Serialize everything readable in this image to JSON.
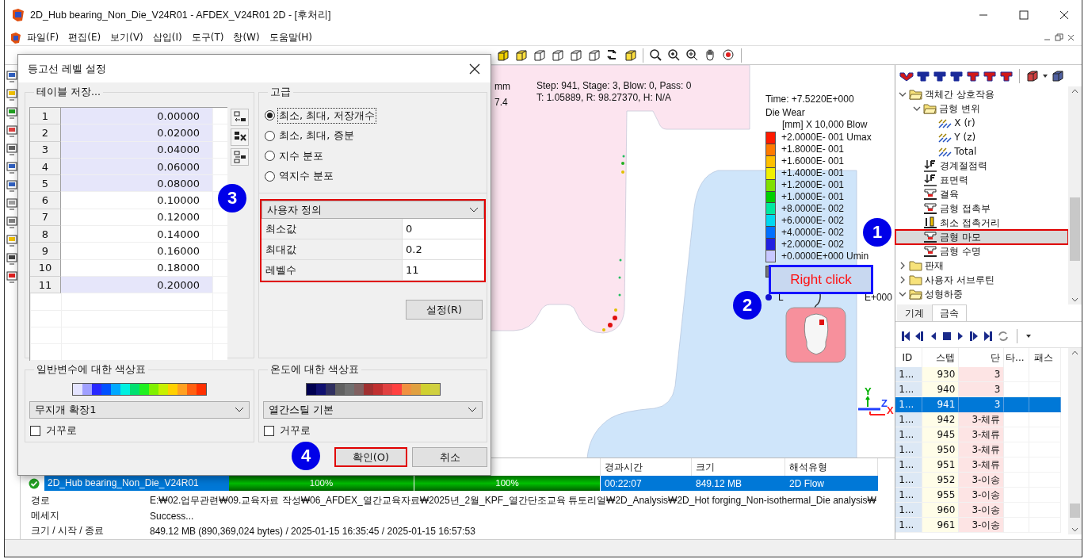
{
  "window": {
    "title": "2D_Hub bearing_Non_Die_V24R01 - AFDEX_V24R01 2D - [후처리]"
  },
  "menu": [
    "파일(F)",
    "편집(E)",
    "보기(V)",
    "삽입(I)",
    "도구(T)",
    "창(W)",
    "도움말(H)"
  ],
  "viewport": {
    "corner_texts": [
      "mm",
      "7.4"
    ],
    "step_info": [
      "Step: 941, Stage: 3, Blow: 0, Pass: 0",
      "T: 1.05889, R: 98.27370, H: N/A"
    ],
    "legend": {
      "time": "Time: +7.5220E+000",
      "variable": "Die Wear",
      "unit": "[mm] X 10,000 Blow",
      "footer_left": "L",
      "footer_right": "E+000",
      "levels": [
        {
          "label": "+2.0000E- 001 Umax",
          "color": "#ff1a00"
        },
        {
          "label": "+1.8000E- 001",
          "color": "#ff7a00"
        },
        {
          "label": "+1.6000E- 001",
          "color": "#ffc000"
        },
        {
          "label": "+1.4000E- 001",
          "color": "#f0f000"
        },
        {
          "label": "+1.2000E- 001",
          "color": "#80e000"
        },
        {
          "label": "+1.0000E- 001",
          "color": "#00d000"
        },
        {
          "label": "+8.0000E- 002",
          "color": "#00e8a0"
        },
        {
          "label": "+6.0000E- 002",
          "color": "#00d8f0"
        },
        {
          "label": "+4.0000E- 002",
          "color": "#0070ff"
        },
        {
          "label": "+2.0000E- 002",
          "color": "#2020e0"
        },
        {
          "label": "+0.0000E+000 Umin",
          "color": "#c8c8ff"
        }
      ]
    },
    "axes": [
      {
        "label": "Y",
        "color": "#00b000"
      },
      {
        "label": "Z",
        "color": "#2040ff"
      },
      {
        "label": "X",
        "color": "#ff2020"
      }
    ]
  },
  "dialog": {
    "title": "등고선 레벨 설정",
    "table_group": {
      "title": "테이블 저장...",
      "rows": [
        {
          "index": "1",
          "value": "0.00000",
          "selected": true
        },
        {
          "index": "2",
          "value": "0.02000",
          "selected": true
        },
        {
          "index": "3",
          "value": "0.04000",
          "selected": true
        },
        {
          "index": "4",
          "value": "0.06000",
          "selected": true
        },
        {
          "index": "5",
          "value": "0.08000",
          "selected": true
        },
        {
          "index": "6",
          "value": "0.10000",
          "selected": false
        },
        {
          "index": "7",
          "value": "0.12000",
          "selected": false
        },
        {
          "index": "8",
          "value": "0.14000",
          "selected": false
        },
        {
          "index": "9",
          "value": "0.16000",
          "selected": false
        },
        {
          "index": "10",
          "value": "0.18000",
          "selected": false
        },
        {
          "index": "11",
          "value": "0.20000",
          "selected": true
        }
      ]
    },
    "advanced": {
      "title": "고급",
      "options": [
        {
          "label": "최소, 최대, 저장개수",
          "selected": true
        },
        {
          "label": "최소, 최대, 증분",
          "selected": false
        },
        {
          "label": "지수 분포",
          "selected": false
        },
        {
          "label": "역지수 분포",
          "selected": false
        }
      ],
      "user_defined": {
        "highlighted": true,
        "mode": "사용자 정의",
        "fields": [
          {
            "label": "최소값",
            "value": "0"
          },
          {
            "label": "최대값",
            "value": "0.2"
          },
          {
            "label": "레벨수",
            "value": "11"
          }
        ]
      },
      "apply_button": "설정(R)"
    },
    "colormaps": [
      {
        "title": "일반변수에 대한 색상표",
        "value": "무지개 확장1",
        "reversed_label": "거꾸로",
        "reversed": false,
        "swatches": [
          {
            "color": "#e4e4ff"
          },
          {
            "color": "#a0a0ff"
          },
          {
            "color": "#2828ff"
          },
          {
            "color": "#0050ff"
          },
          {
            "color": "#00a8ff"
          },
          {
            "color": "#00f0e0"
          },
          {
            "color": "#00e070"
          },
          {
            "color": "#20f020"
          },
          {
            "color": "#80f000"
          },
          {
            "color": "#c8f000"
          },
          {
            "color": "#ffd000"
          },
          {
            "color": "#ffa020"
          },
          {
            "color": "#ff6010"
          },
          {
            "color": "#ff3000"
          }
        ]
      },
      {
        "title": "온도에 대한 색상표",
        "value": "열간스틸 기본",
        "reversed_label": "거꾸로",
        "reversed": false,
        "swatches": [
          {
            "color": "#000050"
          },
          {
            "color": "#101070"
          },
          {
            "color": "#303060"
          },
          {
            "color": "#606060"
          },
          {
            "color": "#707070"
          },
          {
            "color": "#806060"
          },
          {
            "color": "#a03030"
          },
          {
            "color": "#c03030"
          },
          {
            "color": "#e04040"
          },
          {
            "color": "#ff4040"
          },
          {
            "color": "#f09040"
          },
          {
            "color": "#e0a040"
          },
          {
            "color": "#d0d030"
          },
          {
            "color": "#d0d040"
          }
        ]
      }
    ],
    "buttons": [
      {
        "label": "확인(O)",
        "highlighted": true
      },
      {
        "label": "취소",
        "highlighted": false
      }
    ]
  },
  "right_panel": {
    "tree": [
      {
        "label": "객체간 상호작용",
        "kind": "folder",
        "expanded": true,
        "selected": false,
        "highlighted": false,
        "children": [
          {
            "label": "금형 변위",
            "kind": "folder",
            "expanded": true,
            "selected": false,
            "highlighted": false,
            "children": [
              {
                "label": "X (r)",
                "kind": "vector",
                "selected": false,
                "highlighted": false
              },
              {
                "label": "Y (z)",
                "kind": "vector",
                "selected": false,
                "highlighted": false
              },
              {
                "label": "Total",
                "kind": "vector",
                "selected": false,
                "highlighted": false
              }
            ]
          },
          {
            "label": "경계절점력",
            "kind": "force",
            "selected": false,
            "highlighted": false
          },
          {
            "label": "표면력",
            "kind": "force",
            "selected": false,
            "highlighted": false
          },
          {
            "label": "결육",
            "kind": "die",
            "selected": false,
            "highlighted": false
          },
          {
            "label": "금형 접촉부",
            "kind": "die",
            "selected": false,
            "highlighted": false
          },
          {
            "label": "최소 접촉거리",
            "kind": "gauge",
            "selected": false,
            "highlighted": false
          },
          {
            "label": "금형 마모",
            "kind": "die",
            "selected": true,
            "highlighted": true
          },
          {
            "label": "금형 수명",
            "kind": "die",
            "selected": false,
            "highlighted": false
          }
        ]
      },
      {
        "label": "판재",
        "kind": "folder",
        "expanded": false,
        "selected": false,
        "highlighted": false
      },
      {
        "label": "사용자 서브루틴",
        "kind": "folder",
        "expanded": false,
        "selected": false,
        "highlighted": false
      },
      {
        "label": "성형하중",
        "kind": "folder",
        "expanded": true,
        "selected": false,
        "highlighted": false
      }
    ],
    "tabs": [
      {
        "label": "기계",
        "selected": false
      },
      {
        "label": "금속",
        "selected": true
      }
    ],
    "steps_table": {
      "columns": [
        "ID",
        "스텝",
        "단",
        "타...",
        "패스"
      ],
      "rows": [
        {
          "id": "1...",
          "step": "930",
          "stage": "3",
          "selected": false
        },
        {
          "id": "1...",
          "step": "940",
          "stage": "3",
          "selected": false
        },
        {
          "id": "1...",
          "step": "941",
          "stage": "3",
          "selected": true
        },
        {
          "id": "1...",
          "step": "942",
          "stage": "3-체류",
          "selected": false
        },
        {
          "id": "1...",
          "step": "945",
          "stage": "3-체류",
          "selected": false
        },
        {
          "id": "1...",
          "step": "950",
          "stage": "3-체류",
          "selected": false
        },
        {
          "id": "1...",
          "step": "951",
          "stage": "3-체류",
          "selected": false
        },
        {
          "id": "1...",
          "step": "952",
          "stage": "3-이송",
          "selected": false
        },
        {
          "id": "1...",
          "step": "955",
          "stage": "3-이송",
          "selected": false
        },
        {
          "id": "1...",
          "step": "960",
          "stage": "3-이송",
          "selected": false
        },
        {
          "id": "1...",
          "step": "961",
          "stage": "3-이송",
          "selected": false
        }
      ]
    }
  },
  "jobs": {
    "columns": [
      "경과시간",
      "크기",
      "해석유형"
    ],
    "row": {
      "kind": "done",
      "selected": true,
      "name": "2D_Hub bearing_Non_Die_V24R01",
      "progress": [
        {
          "label": "100%",
          "level": 1
        },
        {
          "label": "100%",
          "level": 1
        }
      ],
      "elapsed": "00:22:07",
      "size": "849.12 MB",
      "type": "2D Flow"
    },
    "info": [
      {
        "label": "경로",
        "value": "E:₩02.업무관련₩09.교육자료 작성₩06_AFDEX_열간교육자료₩2025년_2월_KPF_열간단조교육 튜토리얼₩2D_Analysis₩2D_Hot forging_Non-isothermal_Die analysis₩"
      },
      {
        "label": "메세지",
        "value": "Success..."
      },
      {
        "label": "크기 / 시작 / 종료",
        "value": "849.12 MB (890,369,024 bytes) / 2025-01-15 16:35:45 / 2025-01-15 16:57:53"
      }
    ]
  },
  "annotations": [
    {
      "text": "1"
    },
    {
      "text": "2"
    },
    {
      "text": "3"
    },
    {
      "text": "4"
    }
  ],
  "callout": {
    "text": "Right click"
  }
}
